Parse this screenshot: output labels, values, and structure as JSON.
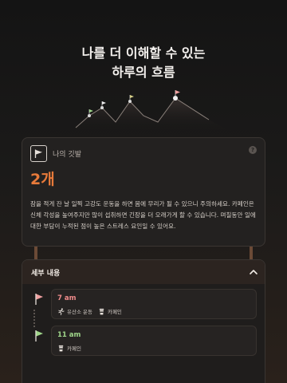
{
  "hero": {
    "line1": "나를 더 이해할 수 있는",
    "line2": "하루의 흐름"
  },
  "summary_card": {
    "label": "나의 깃발",
    "count": "2개",
    "help": "?",
    "description": "잠을 적게 잔 날 일찍 고강도 운동을 하면 몸에 무리가 될 수 있으니 주의하세요. 카페인은 신체 각성을 높여주지만 많이 섭취하면 긴장을 더 오래가게 할 수 있습니다. 며칠동안 일에 대한 부담이 누적된 점이 높은 스트레스 요인일 수 있어요."
  },
  "details": {
    "title": "세부 내용",
    "entries": [
      {
        "time": "7 am",
        "tags": [
          {
            "icon": "running-icon",
            "label": "유산소 운동"
          },
          {
            "icon": "coffee-icon",
            "label": "카페인"
          }
        ]
      },
      {
        "time": "11 am",
        "tags": [
          {
            "icon": "coffee-icon",
            "label": "카페인"
          }
        ]
      }
    ]
  },
  "colors": {
    "accent_orange": "#e87a3a",
    "flag_pink": "#f0a0a0",
    "flag_green": "#9fd68a",
    "connector": "#6b4a36"
  }
}
